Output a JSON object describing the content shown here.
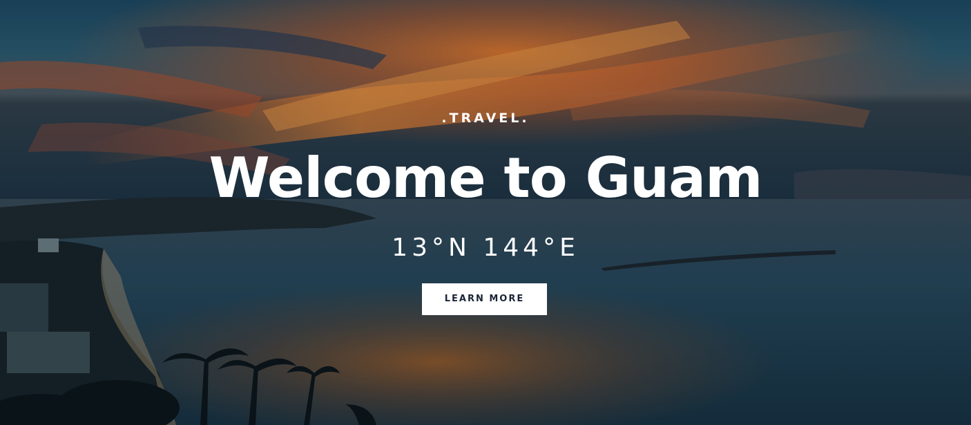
{
  "hero": {
    "eyebrow": ".TRAVEL.",
    "title": "Welcome to Guam",
    "coordinates": "13°N 144°E",
    "cta_label": "LEARN MORE"
  },
  "colors": {
    "text": "#ffffff",
    "button_background": "#ffffff",
    "button_text": "#1a2436"
  }
}
